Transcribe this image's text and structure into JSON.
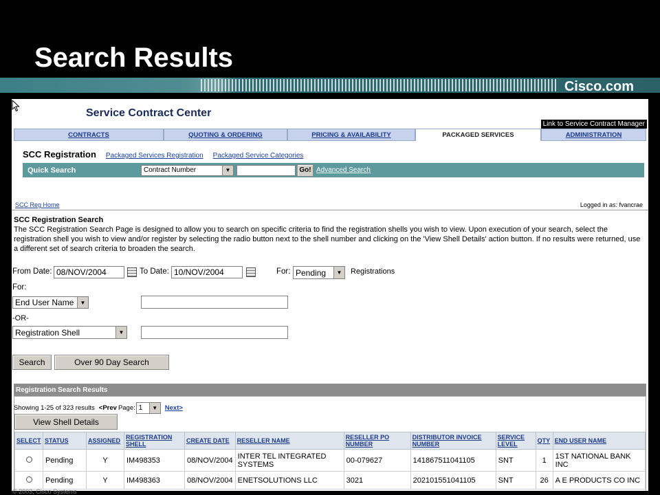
{
  "slide": {
    "title": "Search Results",
    "logo": "Cisco.com",
    "footer": "© 2003, Cisco Systems"
  },
  "app": {
    "title": "Service Contract Center",
    "scm_link": "Link to Service Contract Manager",
    "tabs": [
      {
        "label": "CONTRACTS",
        "active": false
      },
      {
        "label": "QUOTING & ORDERING",
        "active": false
      },
      {
        "label": "PRICING & AVAILABILITY",
        "active": false
      },
      {
        "label": "PACKAGED SERVICES",
        "active": true
      },
      {
        "label": "ADMINISTRATION",
        "active": false
      }
    ],
    "subnav": {
      "title": "SCC Registration",
      "links": [
        "Packaged Services Registration",
        "Packaged Service Categories"
      ]
    },
    "quick_search": {
      "label": "Quick Search",
      "select_value": "Contract Number",
      "input_value": "",
      "go_label": "Go!",
      "advanced_label": "Advanced Search"
    },
    "home_link": "SCC Reg Home",
    "logged_in_prefix": "Logged in",
    "logged_in_as": "as:",
    "logged_in_user": "fvancrae",
    "heading": "SCC Registration Search",
    "description": "The SCC Registration Search Page is designed to allow you to search on specific criteria to find the registration shells you wish to view. Upon execution of your search, select the registration shell you wish to view and/or register by selecting the radio button next to the shell number and clicking on the 'View Shell Details' action button. If no results were returned, use a different set of search criteria to broaden the search.",
    "form": {
      "from_label": "From Date:",
      "from_value": "08/NOV/2004",
      "to_label": "To Date:",
      "to_value": "10/NOV/2004",
      "for_label": "For:",
      "status_value": "Pending",
      "registrations_label": "Registrations",
      "for_label2": "For:",
      "field1_value": "End User Name",
      "field1_input": "",
      "or_label": "-OR-",
      "field2_value": "Registration Shell",
      "field2_input": "",
      "search_button": "Search",
      "over90_button": "Over 90 Day Search"
    },
    "results": {
      "header": "Registration Search Results",
      "showing": "Showing 1-25 of 323 results",
      "prev": "<Prev",
      "page_label": "Page:",
      "page_value": "1",
      "next": "Next>",
      "view_button": "View Shell Details",
      "columns": [
        "SELECT",
        "STATUS",
        "ASSIGNED",
        "REGISTRATION SHELL",
        "CREATE DATE",
        "RESELLER NAME",
        "RESELLER PO NUMBER",
        "DISTRIBUTOR INVOICE NUMBER",
        "SERVICE LEVEL",
        "QTY",
        "END USER NAME"
      ],
      "rows": [
        {
          "status": "Pending",
          "assigned": "Y",
          "shell": "IM498353",
          "date": "08/NOV/2004",
          "reseller": "INTER TEL INTEGRATED SYSTEMS",
          "po": "00-079627",
          "invoice": "141867511041105",
          "level": "SNT",
          "qty": "1",
          "enduser": "1ST NATIONAL BANK INC"
        },
        {
          "status": "Pending",
          "assigned": "Y",
          "shell": "IM498363",
          "date": "08/NOV/2004",
          "reseller": "ENETSOLUTIONS LLC",
          "po": "3021",
          "invoice": "202101551041105",
          "level": "SNT",
          "qty": "26",
          "enduser": "A E PRODUCTS CO INC"
        }
      ]
    }
  }
}
